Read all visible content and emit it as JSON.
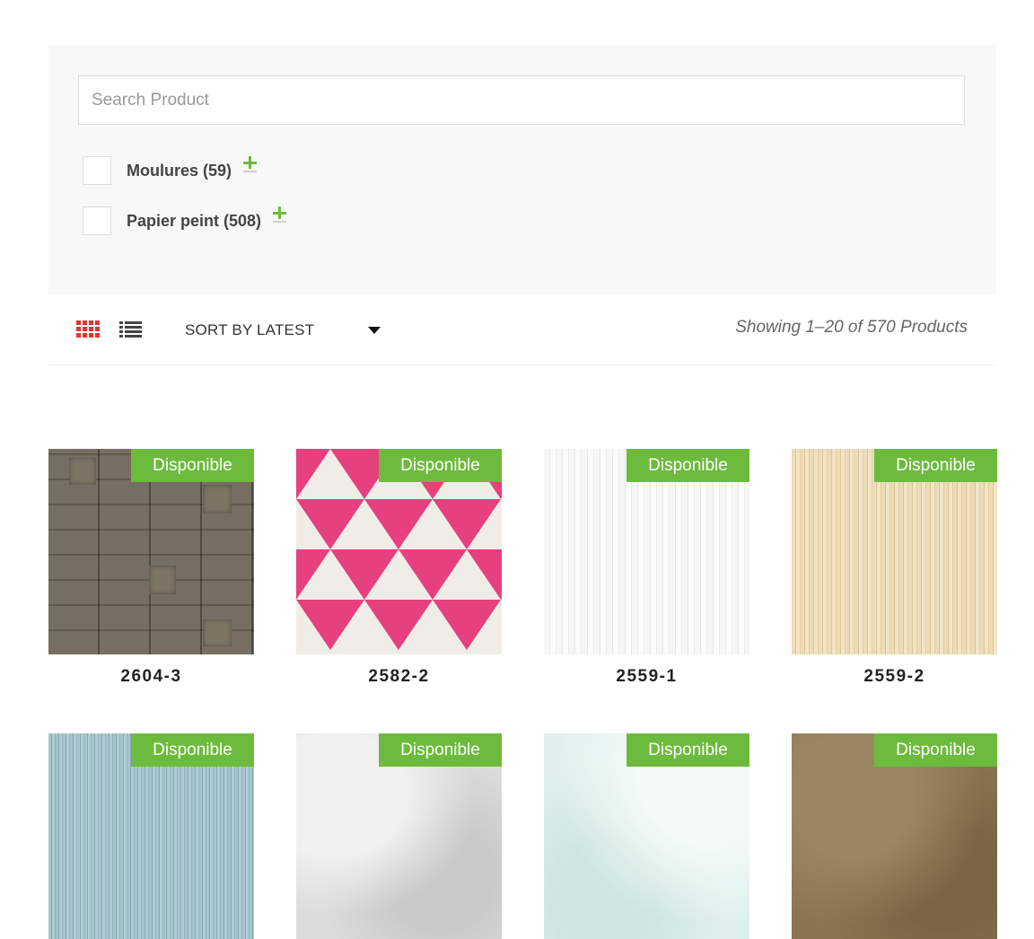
{
  "filters": {
    "search_placeholder": "Search Product",
    "categories": [
      {
        "label": "Moulures (59)"
      },
      {
        "label": "Papier peint (508)"
      }
    ]
  },
  "toolbar": {
    "sort_label": "SORT BY LATEST",
    "result_count": "Showing 1–20 of 570 Products",
    "active_view": "grid",
    "accent_color": "#e63232"
  },
  "badge_color": "#6cbb3c",
  "products": [
    {
      "name": "2604-3",
      "badge": "Disponible",
      "swatch": "grey stone tiles"
    },
    {
      "name": "2582-2",
      "badge": "Disponible",
      "swatch": "pink triangles"
    },
    {
      "name": "2559-1",
      "badge": "Disponible",
      "swatch": "white stripes"
    },
    {
      "name": "2559-2",
      "badge": "Disponible",
      "swatch": "beige stripes"
    },
    {
      "name": "",
      "badge": "Disponible",
      "swatch": "blue stripes"
    },
    {
      "name": "",
      "badge": "Disponible",
      "swatch": "silver texture"
    },
    {
      "name": "",
      "badge": "Disponible",
      "swatch": "mint texture"
    },
    {
      "name": "",
      "badge": "Disponible",
      "swatch": "brown texture"
    }
  ]
}
